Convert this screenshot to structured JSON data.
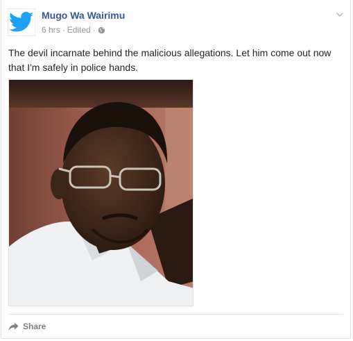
{
  "post": {
    "author": "Mugo Wa Wairimu",
    "time": "6 hrs",
    "separator": "·",
    "edited": "Edited",
    "privacy_icon": "globe-icon",
    "text": "The devil incarnate behind the malicious allegations. Let him come out now that I'm safely in police hands.",
    "avatar_icon": "twitter-bird-icon",
    "image": "photo of a man wearing glasses and a white shirt",
    "options_icon": "chevron-down-icon"
  },
  "actions": {
    "share_label": "Share",
    "share_icon": "share-arrow-icon"
  },
  "colors": {
    "author_link": "#365899",
    "meta_text": "#90949c",
    "twitter_blue": "#1da1f2",
    "body_text": "#1d2129"
  }
}
